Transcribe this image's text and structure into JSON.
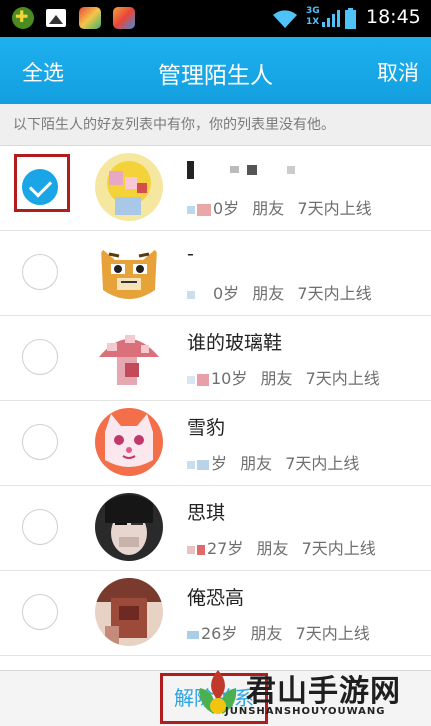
{
  "status_bar": {
    "time": "18:45",
    "network": "3G",
    "network2": "1X",
    "icons": [
      "app-icon",
      "gallery-icon",
      "app-icon",
      "app-icon",
      "wifi-icon",
      "signal-icon",
      "battery-icon"
    ]
  },
  "header": {
    "select_all": "全选",
    "title": "管理陌生人",
    "cancel": "取消"
  },
  "notice": "以下陌生人的好友列表中有你，你的列表里没有他。",
  "contacts": [
    {
      "name": "",
      "age": "0岁",
      "relation": "朋友",
      "last_online": "7天内上线",
      "checked": true,
      "avatar": "yellow-cartoon"
    },
    {
      "name": "-",
      "age": "0岁",
      "relation": "朋友",
      "last_online": "7天内上线",
      "checked": false,
      "avatar": "tiger-cartoon"
    },
    {
      "name": "谁的玻璃鞋",
      "age": "10岁",
      "relation": "朋友",
      "last_online": "7天内上线",
      "checked": false,
      "avatar": "mushroom"
    },
    {
      "name": "雪豹",
      "age": "岁",
      "relation": "朋友",
      "last_online": "7天内上线",
      "checked": false,
      "avatar": "white-cat"
    },
    {
      "name": "思琪",
      "age": "27岁",
      "relation": "朋友",
      "last_online": "7天内上线",
      "checked": false,
      "avatar": "photo"
    },
    {
      "name": "俺恐高",
      "age": "26岁",
      "relation": "朋友",
      "last_online": "7天内上线",
      "checked": false,
      "avatar": "photo"
    }
  ],
  "bottom": {
    "button": "解除关系"
  },
  "watermark": {
    "title": "君山手游网",
    "subtitle": "JUNSHANSHOUYOUWANG"
  },
  "colors": {
    "accent": "#17a7e8",
    "highlight_box": "#b11d1d"
  }
}
